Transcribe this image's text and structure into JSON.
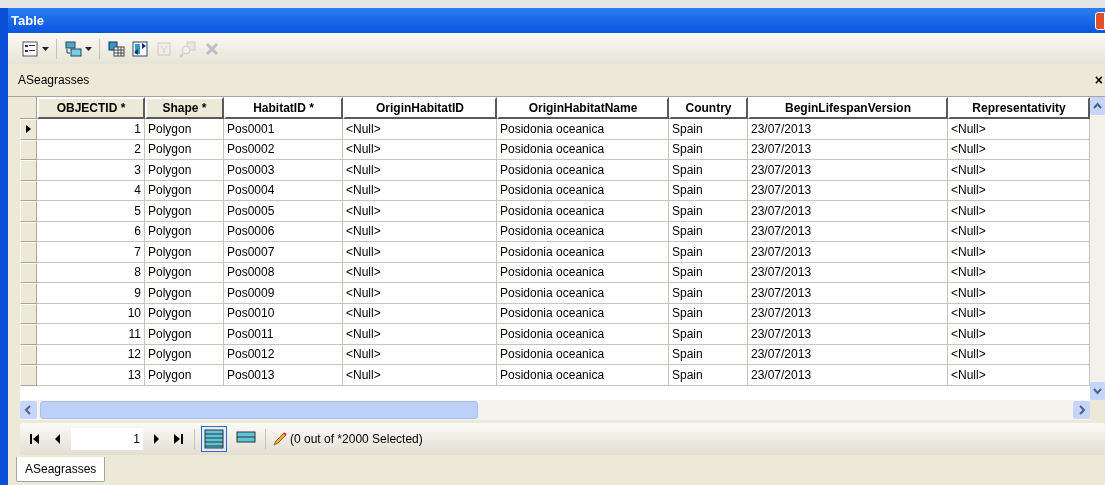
{
  "window": {
    "title": "Table"
  },
  "toolbar": [
    {
      "kind": "options",
      "dropdown": true,
      "disabled": false
    },
    {
      "kind": "related",
      "dropdown": true,
      "disabled": false
    },
    {
      "kind": "select-by",
      "dropdown": false,
      "disabled": false
    },
    {
      "kind": "switch",
      "dropdown": false,
      "disabled": false
    },
    {
      "kind": "clear",
      "dropdown": false,
      "disabled": true
    },
    {
      "kind": "zoom",
      "dropdown": false,
      "disabled": true
    },
    {
      "kind": "delete",
      "dropdown": false,
      "disabled": true
    }
  ],
  "layer": {
    "name": "ASeagrasses",
    "close": "×"
  },
  "table": {
    "columns": [
      "OBJECTID *",
      "Shape *",
      "HabitatID *",
      "OriginHabitatID",
      "OriginHabitatName",
      "Country",
      "BeginLifespanVersion",
      "Representativity"
    ],
    "rows": [
      {
        "current": true,
        "cells": [
          "1",
          "Polygon",
          "Pos0001",
          "<Null>",
          "Posidonia oceanica",
          "Spain",
          "23/07/2013",
          "<Null>"
        ]
      },
      {
        "current": false,
        "cells": [
          "2",
          "Polygon",
          "Pos0002",
          "<Null>",
          "Posidonia oceanica",
          "Spain",
          "23/07/2013",
          "<Null>"
        ]
      },
      {
        "current": false,
        "cells": [
          "3",
          "Polygon",
          "Pos0003",
          "<Null>",
          "Posidonia oceanica",
          "Spain",
          "23/07/2013",
          "<Null>"
        ]
      },
      {
        "current": false,
        "cells": [
          "4",
          "Polygon",
          "Pos0004",
          "<Null>",
          "Posidonia oceanica",
          "Spain",
          "23/07/2013",
          "<Null>"
        ]
      },
      {
        "current": false,
        "cells": [
          "5",
          "Polygon",
          "Pos0005",
          "<Null>",
          "Posidonia oceanica",
          "Spain",
          "23/07/2013",
          "<Null>"
        ]
      },
      {
        "current": false,
        "cells": [
          "6",
          "Polygon",
          "Pos0006",
          "<Null>",
          "Posidonia oceanica",
          "Spain",
          "23/07/2013",
          "<Null>"
        ]
      },
      {
        "current": false,
        "cells": [
          "7",
          "Polygon",
          "Pos0007",
          "<Null>",
          "Posidonia oceanica",
          "Spain",
          "23/07/2013",
          "<Null>"
        ]
      },
      {
        "current": false,
        "cells": [
          "8",
          "Polygon",
          "Pos0008",
          "<Null>",
          "Posidonia oceanica",
          "Spain",
          "23/07/2013",
          "<Null>"
        ]
      },
      {
        "current": false,
        "cells": [
          "9",
          "Polygon",
          "Pos0009",
          "<Null>",
          "Posidonia oceanica",
          "Spain",
          "23/07/2013",
          "<Null>"
        ]
      },
      {
        "current": false,
        "cells": [
          "10",
          "Polygon",
          "Pos0010",
          "<Null>",
          "Posidonia oceanica",
          "Spain",
          "23/07/2013",
          "<Null>"
        ]
      },
      {
        "current": false,
        "cells": [
          "11",
          "Polygon",
          "Pos0011",
          "<Null>",
          "Posidonia oceanica",
          "Spain",
          "23/07/2013",
          "<Null>"
        ]
      },
      {
        "current": false,
        "cells": [
          "12",
          "Polygon",
          "Pos0012",
          "<Null>",
          "Posidonia oceanica",
          "Spain",
          "23/07/2013",
          "<Null>"
        ]
      },
      {
        "current": false,
        "cells": [
          "13",
          "Polygon",
          "Pos0013",
          "<Null>",
          "Posidonia oceanica",
          "Spain",
          "23/07/2013",
          "<Null>"
        ]
      }
    ]
  },
  "navigator": {
    "record": "1",
    "views": [
      {
        "kind": "all",
        "selected": true
      },
      {
        "kind": "selected",
        "selected": false
      }
    ],
    "status": "(0 out of *2000 Selected)"
  },
  "tabs": [
    {
      "label": "ASeagrasses",
      "selected": true
    }
  ]
}
